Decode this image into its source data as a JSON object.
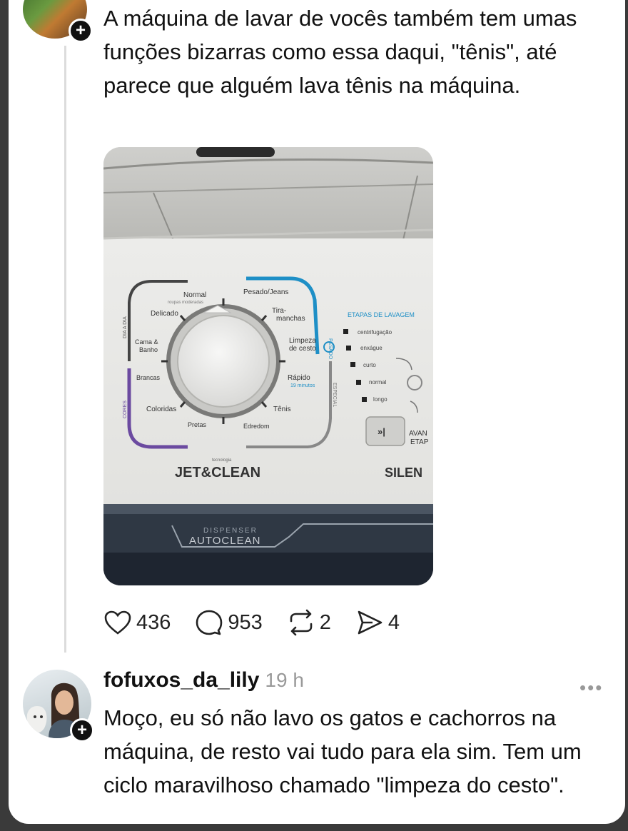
{
  "post": {
    "text": "A máquina de lavar de vocês também tem umas funções bizarras como essa daqui, \"tênis\", até parece que alguém lava tênis na máquina."
  },
  "panel": {
    "normal": "Normal",
    "normal_sub": "roupas moderadas",
    "pesado_jeans": "Pesado/Jeans",
    "delicado": "Delicado",
    "tira_manchas": "Tira-\nmanchas",
    "cama_banho": "Cama &\nBanho",
    "limpeza_cesto": "Limpeza\nde cesto",
    "brancas": "Brancas",
    "rapido": "Rápido",
    "rapido_sub": "19 minutos",
    "coloridas": "Coloridas",
    "tenis": "Tênis",
    "pretas": "Pretas",
    "edredom": "Edredom",
    "dia_a_dia": "DIA A DIA",
    "cores": "CORES",
    "pesado": "PESADO",
    "especial": "ESPECIAL",
    "etapas_title": "ETAPAS DE LAVAGEM",
    "etapas": [
      "centrifugação",
      "enxágue",
      "curto",
      "normal",
      "longo"
    ],
    "tecnologia": "tecnologia",
    "jet_clean": "JET&CLEAN",
    "silent": "SILEN",
    "avanca": "AVAN",
    "etapa": "ETAP",
    "dispenser": "DISPENSER",
    "autoclean": "AUTOCLEAN"
  },
  "actions": {
    "likes": "436",
    "comments": "953",
    "reposts": "2",
    "shares": "4"
  },
  "reply": {
    "username": "fofuxos_da_lily",
    "time": "19 h",
    "more": "•••",
    "text": "Moço, eu só não lavo os gatos e cachorros na máquina, de resto vai tudo para ela sim. Tem um ciclo maravilhoso chamado \"limpeza do cesto\"."
  },
  "colors": {
    "accent_blue": "#1e8fc6",
    "accent_purple": "#6b4aa0",
    "dial_ring": "#6e6e6e"
  }
}
